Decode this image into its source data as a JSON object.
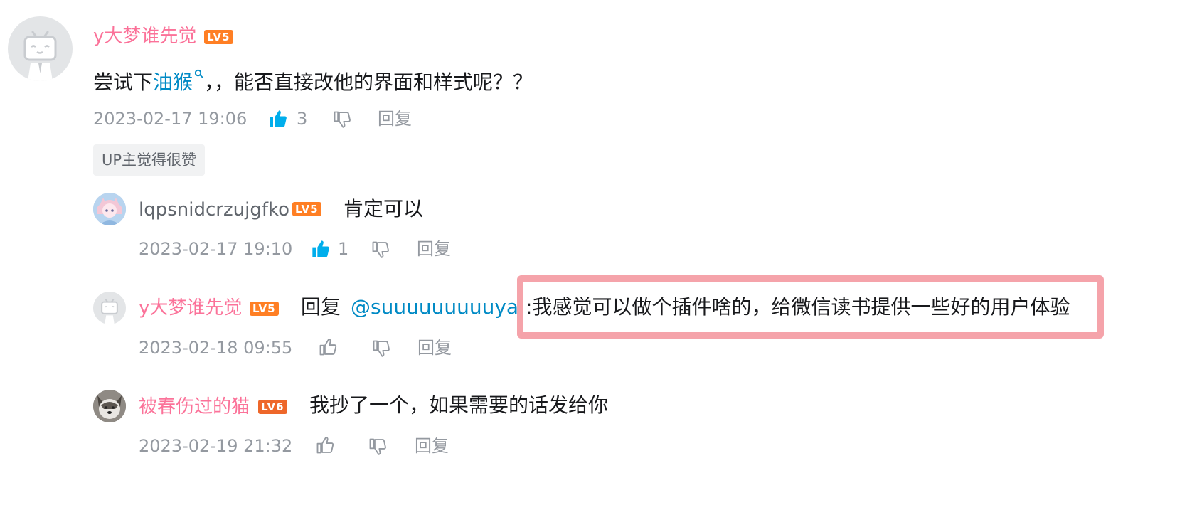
{
  "colors": {
    "username_pink": "#fb7299",
    "link_blue": "#008ac5",
    "meta_grey": "#9499a0",
    "like_active": "#00aeec",
    "highlight_border": "#f5a3aa"
  },
  "main_comment": {
    "username": "y大梦谁先觉",
    "level": "LV5",
    "text_before": "尝试下",
    "link_text": "油猴",
    "text_after": "，，能否直接改他的界面和样式呢？？",
    "date": "2023-02-17 19:06",
    "likes": "3",
    "reply_label": "回复",
    "tag": "UP主觉得很赞"
  },
  "replies": [
    {
      "username": "lqpsnidcrzujgfko",
      "level": "LV5",
      "text": "肯定可以",
      "date": "2023-02-17 19:10",
      "likes": "1",
      "reply_label": "回复"
    },
    {
      "username": "y大梦谁先觉",
      "level": "LV5",
      "reply_prefix": "回复",
      "mention": "@suuuuuuuuuya",
      "separator": ":",
      "text": "我感觉可以做个插件啥的，给微信读书提供一些好的用户体验",
      "date": "2023-02-18 09:55",
      "reply_label": "回复"
    },
    {
      "username": "被春伤过的猫",
      "level": "LV6",
      "text": "我抄了一个，如果需要的话发给你",
      "date": "2023-02-19 21:32",
      "reply_label": "回复"
    }
  ]
}
